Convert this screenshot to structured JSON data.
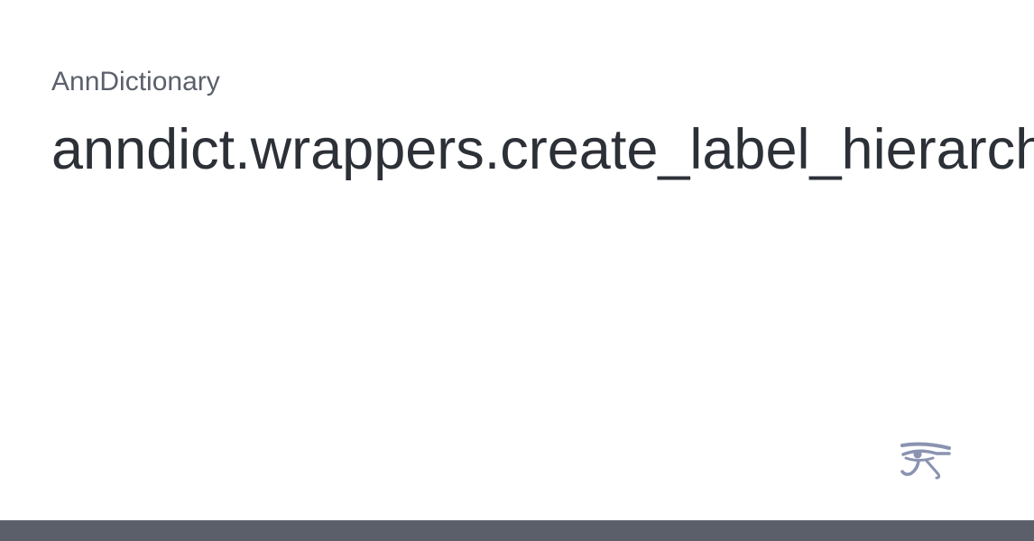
{
  "card": {
    "site_name": "AnnDictionary",
    "title": "anndict.wrappers.create_label_hierarchy",
    "logo_icon": "eye-of-horus-icon",
    "bar_color": "#5a5f6a",
    "logo_color": "#8a93b0"
  }
}
